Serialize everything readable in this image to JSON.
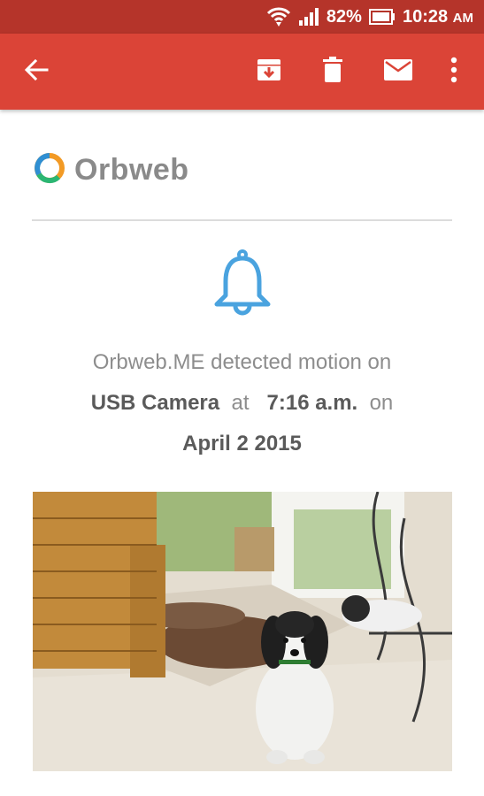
{
  "status_bar": {
    "battery_percent": "82%",
    "time": "10:28",
    "ampm": "AM"
  },
  "toolbar": {
    "icons": [
      "back-arrow-icon",
      "archive-icon",
      "delete-icon",
      "mark-unread-icon",
      "more-options-icon"
    ]
  },
  "email": {
    "brand": "Orbweb",
    "message_prefix": "Orbweb.ME detected motion on",
    "camera_name": "USB Camera",
    "at_word": "at",
    "time": "7:16 a.m.",
    "on_word": "on",
    "date": "April 2 2015",
    "accent_color": "#4aa3df"
  },
  "colors": {
    "status_bar": "#b5342a",
    "app_bar": "#db4437"
  }
}
